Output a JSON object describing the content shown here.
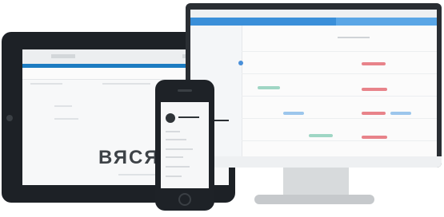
{
  "scene": {
    "tablet_heading": "ВЯСЯЧ",
    "colors": {
      "device_dark": "#1d2126",
      "accent_blue": "#1c7cc1",
      "pill_red": "#e8838a",
      "pill_green": "#9fd6c4",
      "pill_blue": "#9cc6ec"
    }
  }
}
